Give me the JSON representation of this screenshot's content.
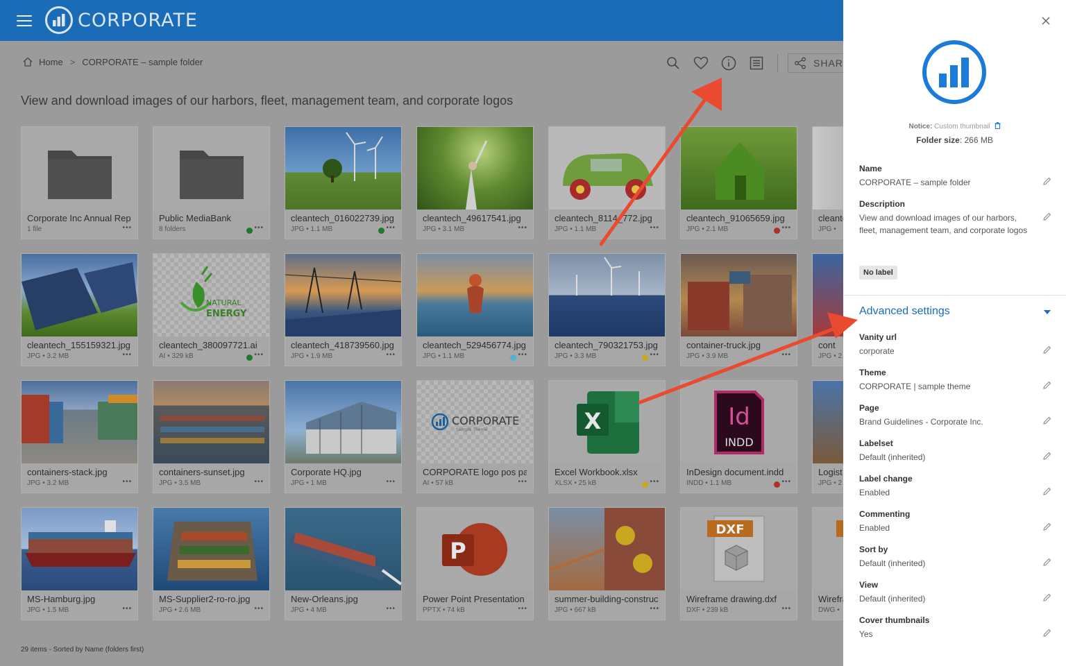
{
  "header": {
    "brand": "CORPORATE",
    "brand_color": "#1a6cb8"
  },
  "breadcrumb": {
    "home": "Home",
    "separator": ">",
    "current": "CORPORATE – sample folder"
  },
  "toolbar": {
    "share_label": "SHARE"
  },
  "description": "View and download images of our harbors, fleet, management team, and corporate logos",
  "items": [
    {
      "name": "Corporate Inc Annual Rep",
      "meta": "1 file",
      "dot": ""
    },
    {
      "name": "Public MediaBank",
      "meta": "8 folders",
      "dot": "#1e8a2e"
    },
    {
      "name": "cleantech_016022739.jpg",
      "meta": "JPG • 1.1 MB",
      "dot": "#1e8a2e"
    },
    {
      "name": "cleantech_49617541.jpg",
      "meta": "JPG • 3.1 MB",
      "dot": ""
    },
    {
      "name": "cleantech_8114_772.jpg",
      "meta": "JPG • 1.1 MB",
      "dot": ""
    },
    {
      "name": "cleantech_91065659.jpg",
      "meta": "JPG • 2.1 MB",
      "dot": "#c0392b"
    },
    {
      "name": "cleante",
      "meta": "JPG •",
      "dot": ""
    },
    {
      "name": "cleantech_155159321.jpg",
      "meta": "JPG • 3.2 MB",
      "dot": ""
    },
    {
      "name": "cleantech_380097721.ai",
      "meta": "AI • 329 kB",
      "dot": "#1e8a2e"
    },
    {
      "name": "cleantech_418739560.jpg",
      "meta": "JPG • 1.9 MB",
      "dot": ""
    },
    {
      "name": "cleantech_529456774.jpg",
      "meta": "JPG • 1.1 MB",
      "dot": "#4fb3d9"
    },
    {
      "name": "cleantech_790321753.jpg",
      "meta": "JPG • 3.3 MB",
      "dot": "#d4b020"
    },
    {
      "name": "container-truck.jpg",
      "meta": "JPG • 3.9 MB",
      "dot": ""
    },
    {
      "name": "cont",
      "meta": "JPG • 2",
      "dot": ""
    },
    {
      "name": "containers-stack.jpg",
      "meta": "JPG • 3.2 MB",
      "dot": ""
    },
    {
      "name": "containers-sunset.jpg",
      "meta": "JPG • 3.5 MB",
      "dot": ""
    },
    {
      "name": "Corporate HQ.jpg",
      "meta": "JPG • 1 MB",
      "dot": ""
    },
    {
      "name": "CORPORATE logo pos pay",
      "meta": "AI • 57 kB",
      "dot": ""
    },
    {
      "name": "Excel Workbook.xlsx",
      "meta": "XLSX • 25 kB",
      "dot": "#d4b020"
    },
    {
      "name": "InDesign document.indd",
      "meta": "INDD • 1.1 MB",
      "dot": "#c0392b"
    },
    {
      "name": "Logist",
      "meta": "JPG • 2",
      "dot": ""
    },
    {
      "name": "MS-Hamburg.jpg",
      "meta": "JPG • 1.5 MB",
      "dot": ""
    },
    {
      "name": "MS-Supplier2-ro-ro.jpg",
      "meta": "JPG • 2.6 MB",
      "dot": ""
    },
    {
      "name": "New-Orleans.jpg",
      "meta": "JPG • 4 MB",
      "dot": ""
    },
    {
      "name": "Power Point Presentation",
      "meta": "PPTX • 74 kB",
      "dot": ""
    },
    {
      "name": "summer-building-construc",
      "meta": "JPG • 667 kB",
      "dot": ""
    },
    {
      "name": "Wireframe drawing.dxf",
      "meta": "DXF • 239 kB",
      "dot": ""
    },
    {
      "name": "Wirefra",
      "meta": "DWG •",
      "dot": ""
    }
  ],
  "thumb_labels": {
    "natural": "NATURAL",
    "energy": "ENERGY",
    "corporate_logo": "CORPORATE",
    "corporate_tagline": "Sample Theme",
    "excel": "X",
    "indd_top": "Id",
    "indd_bottom": "INDD",
    "ppt": "P",
    "dxf": "DXF"
  },
  "status": "29 items - Sorted by Name (folders first)",
  "panel": {
    "notice_label": "Notice:",
    "notice_text": "Custom thumbnail",
    "folder_size_label": "Folder size",
    "folder_size": ": 266 MB",
    "name_label": "Name",
    "name_value": "CORPORATE – sample folder",
    "description_label": "Description",
    "description_value": "View and download images of our harbors, fleet, management team, and corporate logos",
    "no_label": "No label",
    "advanced_settings": "Advanced settings",
    "settings": [
      {
        "label": "Vanity url",
        "value": "corporate"
      },
      {
        "label": "Theme",
        "value": "CORPORATE | sample theme"
      },
      {
        "label": "Page",
        "value": "Brand Guidelines - Corporate Inc."
      },
      {
        "label": "Labelset",
        "value": "Default (inherited)"
      },
      {
        "label": "Label change",
        "value": "Enabled"
      },
      {
        "label": "Commenting",
        "value": "Enabled"
      },
      {
        "label": "Sort by",
        "value": "Default (inherited)"
      },
      {
        "label": "View",
        "value": "Default (inherited)"
      },
      {
        "label": "Cover thumbnails",
        "value": "Yes"
      }
    ]
  },
  "annotation_color": "#e8472e"
}
